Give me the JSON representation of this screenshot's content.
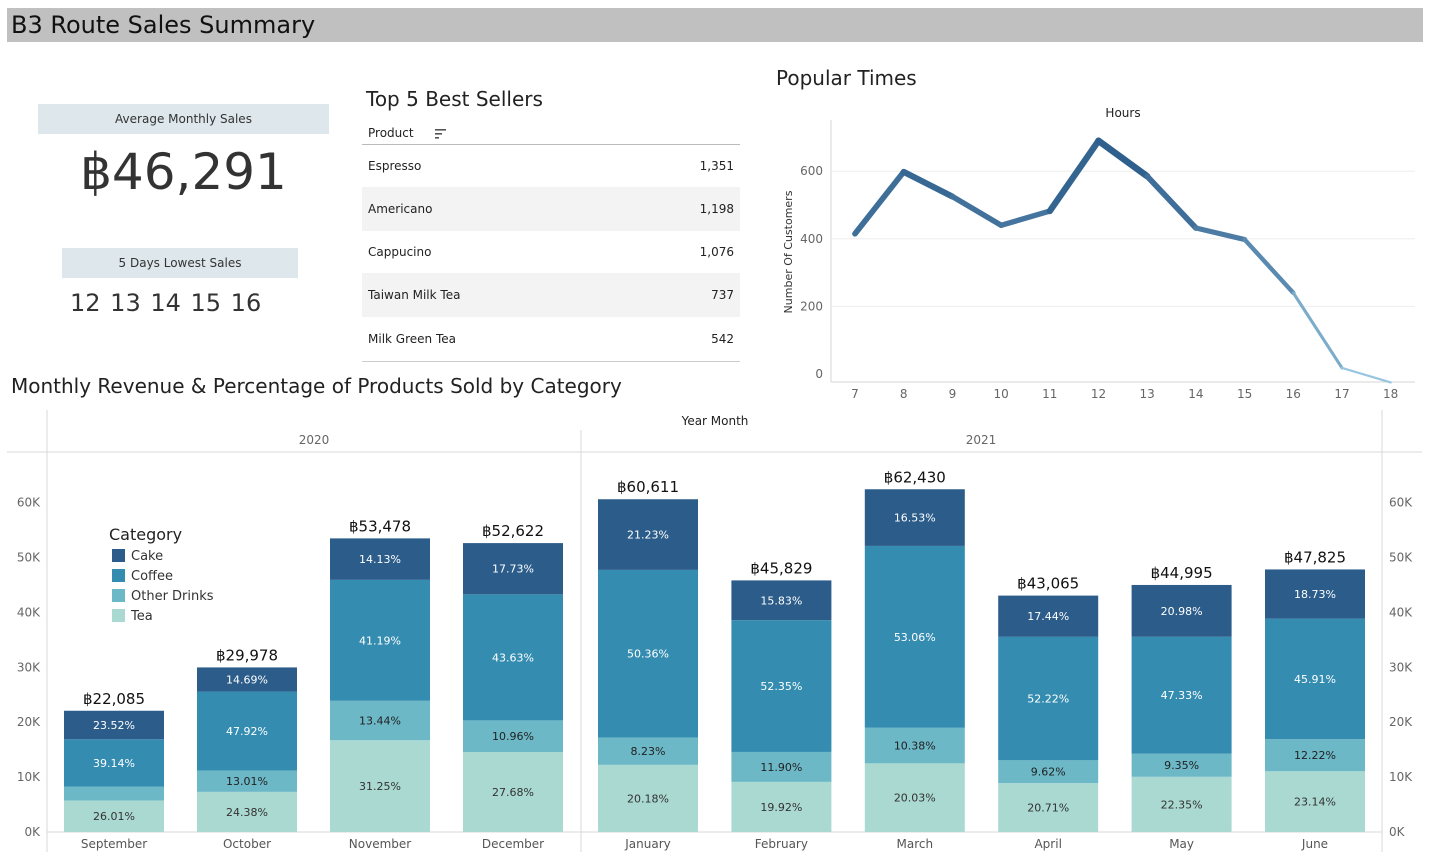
{
  "dashboard": {
    "title": "B3 Route Sales Summary"
  },
  "kpi": {
    "avg_label": "Average Monthly Sales",
    "avg_value": "฿46,291",
    "low_label": "5 Days Lowest Sales",
    "low_days": "12 13 14 15 16"
  },
  "best_sellers": {
    "title": "Top 5 Best Sellers",
    "column_label": "Product",
    "rows": [
      {
        "name": "Espresso",
        "value": "1,351"
      },
      {
        "name": "Americano",
        "value": "1,198"
      },
      {
        "name": "Cappucino",
        "value": "1,076"
      },
      {
        "name": "Taiwan Milk Tea",
        "value": "737"
      },
      {
        "name": "Milk Green Tea",
        "value": "542"
      }
    ]
  },
  "popular_times": {
    "title": "Popular Times"
  },
  "monthly": {
    "title": "Monthly Revenue & Percentage of Products Sold by Category"
  },
  "colors": {
    "cake": "#2b5c8a",
    "coffee": "#348cb0",
    "other_drinks": "#6cb8c7",
    "tea": "#aad9d2",
    "line_dark": "#2b5c8a",
    "line_light": "#9cc9e3"
  },
  "chart_data": [
    {
      "type": "line",
      "x": [
        7,
        8,
        9,
        10,
        11,
        12,
        13,
        14,
        15,
        16,
        17,
        18
      ],
      "y": [
        415,
        598,
        525,
        440,
        482,
        690,
        585,
        432,
        398,
        240,
        18,
        -25
      ],
      "xlabel": "Hours",
      "ylabel": "Number Of Customers",
      "ylim": [
        -25,
        700
      ],
      "yticks": [
        0,
        200,
        400,
        600
      ],
      "grid": true,
      "color_encoding": "gradient by value"
    },
    {
      "type": "bar",
      "stacked": true,
      "column_header": "Year Month",
      "groups": [
        {
          "label": "2020",
          "months": [
            "September",
            "October",
            "November",
            "December"
          ]
        },
        {
          "label": "2021",
          "months": [
            "January",
            "February",
            "March",
            "April",
            "May",
            "June"
          ]
        }
      ],
      "categories": [
        "September",
        "October",
        "November",
        "December",
        "January",
        "February",
        "March",
        "April",
        "May",
        "June"
      ],
      "totals": [
        22085,
        29978,
        53478,
        52622,
        60611,
        45829,
        62430,
        43065,
        44995,
        47825
      ],
      "total_labels": [
        "฿22,085",
        "฿29,978",
        "฿53,478",
        "฿52,622",
        "฿60,611",
        "฿45,829",
        "฿62,430",
        "฿43,065",
        "฿44,995",
        "฿47,825"
      ],
      "series": [
        {
          "name": "Tea",
          "percent": [
            26.01,
            24.38,
            31.25,
            27.68,
            20.18,
            19.92,
            20.03,
            20.71,
            22.35,
            23.14
          ],
          "labels": [
            "26.01%",
            "24.38%",
            "31.25%",
            "27.68%",
            "20.18%",
            "19.92%",
            "20.03%",
            "20.71%",
            "22.35%",
            "23.14%"
          ]
        },
        {
          "name": "Other Drinks",
          "percent": [
            11.33,
            13.01,
            13.44,
            10.96,
            8.23,
            11.9,
            10.38,
            9.62,
            9.35,
            12.22
          ],
          "labels": [
            "",
            "13.01%",
            "13.44%",
            "10.96%",
            "8.23%",
            "11.90%",
            "10.38%",
            "9.62%",
            "9.35%",
            "12.22%"
          ]
        },
        {
          "name": "Coffee",
          "percent": [
            39.14,
            47.92,
            41.19,
            43.63,
            50.36,
            52.35,
            53.06,
            52.22,
            47.33,
            45.91
          ],
          "labels": [
            "39.14%",
            "47.92%",
            "41.19%",
            "43.63%",
            "50.36%",
            "52.35%",
            "53.06%",
            "52.22%",
            "47.33%",
            "45.91%"
          ]
        },
        {
          "name": "Cake",
          "percent": [
            23.52,
            14.69,
            14.13,
            17.73,
            21.23,
            15.83,
            16.53,
            17.44,
            20.98,
            18.73
          ],
          "labels": [
            "23.52%",
            "14.69%",
            "14.13%",
            "17.73%",
            "21.23%",
            "15.83%",
            "16.53%",
            "17.44%",
            "20.98%",
            "18.73%"
          ]
        }
      ],
      "legend_title": "Category",
      "legend": [
        "Cake",
        "Coffee",
        "Other Drinks",
        "Tea"
      ],
      "ylim": [
        0,
        70000
      ],
      "yticks": [
        "0K",
        "10K",
        "20K",
        "30K",
        "40K",
        "50K",
        "60K"
      ],
      "legend_position": "top-left"
    }
  ]
}
